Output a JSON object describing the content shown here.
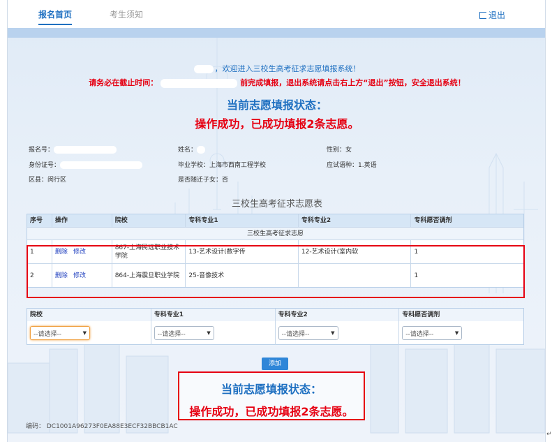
{
  "nav": {
    "tabs": [
      {
        "label": "报名首页",
        "active": true
      },
      {
        "label": "考生须知",
        "active": false
      }
    ],
    "logout_label": "退出"
  },
  "notice": {
    "welcome": "，欢迎进入三校生高考征求志愿填报系统！",
    "deadline_prefix": "请务必在截止时间：",
    "deadline_suffix": "前完成填报，退出系统请点击右上方“退出”按钮，安全退出系统！",
    "status_title": "当前志愿填报状态：",
    "status_message": "操作成功，已成功填报2条志愿。"
  },
  "profile": {
    "reg_no_label": "报名号：",
    "name_label": "姓名：",
    "gender_label": "性别：",
    "gender_value": "女",
    "id_label": "身份证号：",
    "school_label": "毕业学校：",
    "school_value": "上海市西南工程学校",
    "lang_label": "应试语种：",
    "lang_value": "1.英语",
    "district_label": "区县：",
    "district_value": "闵行区",
    "migrant_label": "是否随迁子女：",
    "migrant_value": "否"
  },
  "table": {
    "title": "三校生高考征求志愿表",
    "headers": [
      "序号",
      "操作",
      "院校",
      "专科专业1",
      "专科专业2",
      "专科愿否调剂"
    ],
    "subheader": "三校生高考征求志愿",
    "delete_label": "删除",
    "edit_label": "修改",
    "rows": [
      {
        "no": "1",
        "school": "867-上海民远职业技术学院",
        "major1": "13-艺术设计(数字传",
        "major2": "12-艺术设计(室内软",
        "adjust": "1"
      },
      {
        "no": "2",
        "school": "864-上海震旦职业学院",
        "major1": "25-音像技术",
        "major2": "",
        "adjust": "1"
      }
    ]
  },
  "form": {
    "headers": [
      "院校",
      "专科专业1",
      "专科专业2",
      "专科愿否调剂"
    ],
    "placeholder": "--请选择--",
    "add_label": "添加"
  },
  "footer": {
    "code": "编码： DC1001A96273F0EA88E3ECF32BBCB1AC",
    "corner": "↵"
  },
  "colors": {
    "primary": "#1f70c1",
    "alert": "#e60012"
  }
}
